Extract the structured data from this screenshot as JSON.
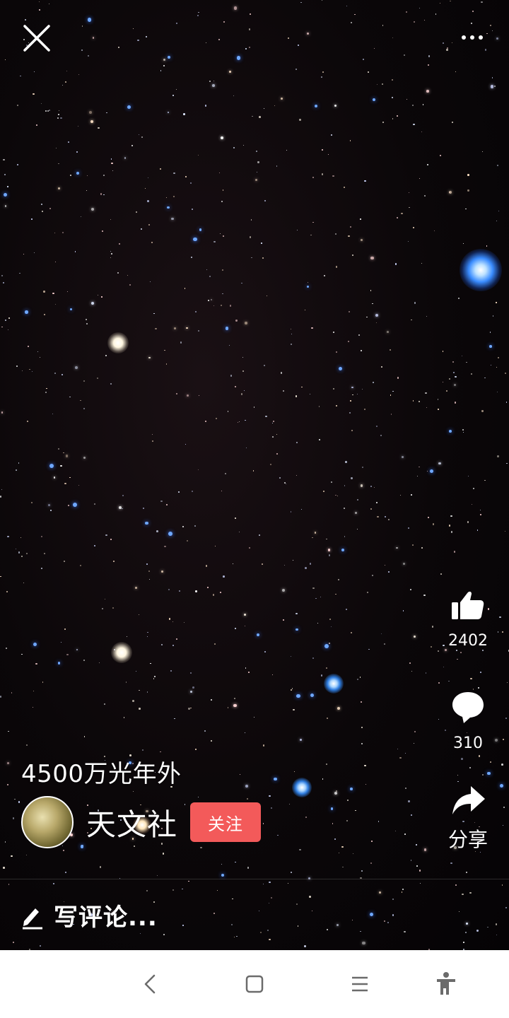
{
  "video": {
    "caption": "4500万光年外"
  },
  "author": {
    "name": "天文社",
    "follow_label": "关注"
  },
  "actions": {
    "like_count": "2402",
    "comment_count": "310",
    "share_label": "分享"
  },
  "comment_bar": {
    "placeholder": "写评论..."
  },
  "icons": {
    "close": "close-icon",
    "more": "more-icon",
    "like": "thumbs-up-icon",
    "comment": "speech-bubble-icon",
    "share": "share-arrow-icon",
    "pencil": "pencil-icon",
    "back": "back-icon",
    "home": "home-icon",
    "menu": "menu-icon",
    "accessibility": "accessibility-icon"
  },
  "colors": {
    "follow_button": "#f35a5a",
    "navbar_background": "#ffffff",
    "nav_icon": "#6b6b6b"
  }
}
